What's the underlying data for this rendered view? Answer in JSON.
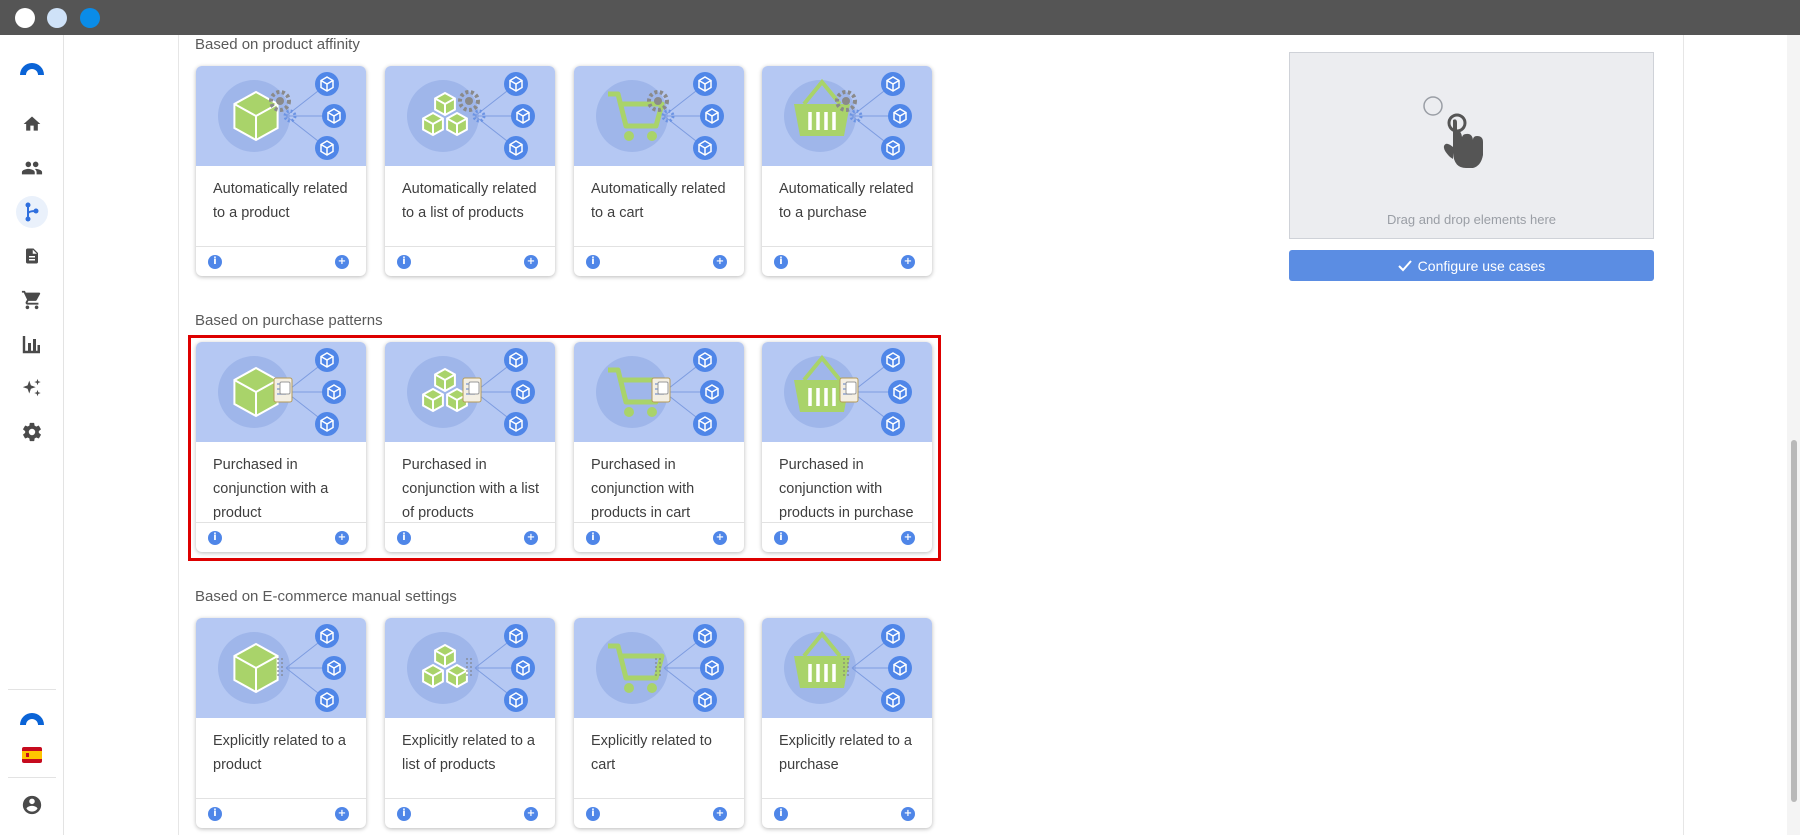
{
  "window": {
    "dots": [
      {
        "name": "close",
        "color": "#ffffff"
      },
      {
        "name": "minimize",
        "color": "#cfe2f8"
      },
      {
        "name": "maximize",
        "color": "#0a8ce8"
      }
    ]
  },
  "sidebar": {
    "items": [
      {
        "icon": "brand-logo-icon"
      },
      {
        "icon": "home-icon"
      },
      {
        "icon": "people-icon"
      },
      {
        "icon": "flow-icon",
        "active": true
      },
      {
        "icon": "document-icon"
      },
      {
        "icon": "cart-icon"
      },
      {
        "icon": "bar-chart-icon"
      },
      {
        "icon": "sparkle-icon"
      },
      {
        "icon": "gear-icon"
      },
      {
        "icon": "brand-logo-icon"
      },
      {
        "icon": "spain-flag-icon"
      },
      {
        "icon": "user-account-icon"
      }
    ]
  },
  "colors": {
    "accent": "#4f86e8",
    "card_image_bg": "#b5c8f3",
    "highlight": "#dd0000",
    "product_green": "#a9d36a"
  },
  "sections": [
    {
      "title": "Based on product affinity",
      "cards": [
        {
          "label": "Automatically related to a product",
          "icon": "product-box-gear-icon"
        },
        {
          "label": "Automatically related to a list of products",
          "icon": "product-list-gear-icon"
        },
        {
          "label": "Automatically related to a cart",
          "icon": "cart-gear-icon"
        },
        {
          "label": "Automatically related to a purchase",
          "icon": "basket-gear-icon"
        }
      ]
    },
    {
      "title": "Based on purchase patterns",
      "cards": [
        {
          "label": "Purchased in conjunction with a product",
          "icon": "product-box-receipt-icon"
        },
        {
          "label": "Purchased in conjunction with a list of products",
          "icon": "product-list-receipt-icon"
        },
        {
          "label": "Purchased in conjunction with products in cart",
          "icon": "cart-receipt-icon"
        },
        {
          "label": "Purchased in conjunction with products in purchase",
          "icon": "basket-receipt-icon"
        }
      ]
    },
    {
      "title": "Based on E-commerce manual settings",
      "cards": [
        {
          "label": "Explicitly related to a product",
          "icon": "product-box-link-icon"
        },
        {
          "label": "Explicitly related to a list of products",
          "icon": "product-list-link-icon"
        },
        {
          "label": "Explicitly related to cart",
          "icon": "cart-link-icon"
        },
        {
          "label": "Explicitly related to a purchase",
          "icon": "basket-link-icon"
        }
      ]
    }
  ],
  "card_actions": {
    "info": "i",
    "add": "+"
  },
  "dropzone": {
    "text": "Drag and drop elements here"
  },
  "configure_button": {
    "label": "Configure use cases"
  }
}
